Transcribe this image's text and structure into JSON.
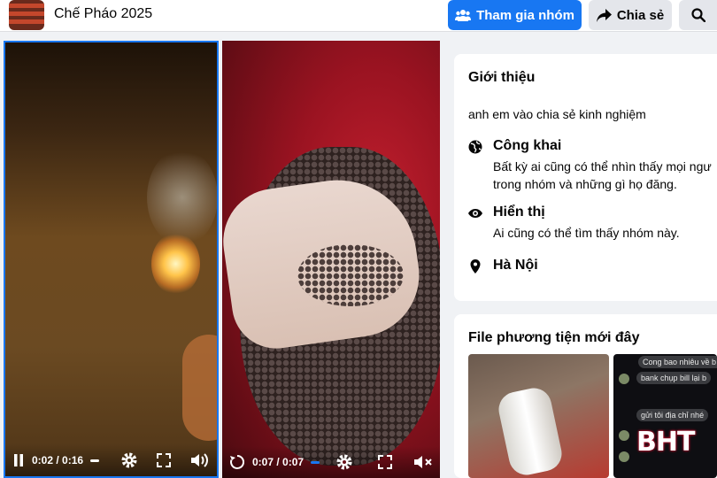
{
  "header": {
    "group_name": "Chế Pháo 2025",
    "join_button": "Tham gia nhóm",
    "share_button": "Chia sẻ",
    "icons": [
      "group-icon",
      "share-arrow-icon",
      "search-icon"
    ]
  },
  "media_viewer": {
    "video_1": {
      "time": "0:02 / 0:16"
    },
    "video_2": {
      "time": "0:07 / 0:07"
    },
    "icons": [
      "pause-icon",
      "replay-icon",
      "settings-icon",
      "fullscreen-icon",
      "volume-icon",
      "mute-icon"
    ]
  },
  "about": {
    "heading": "Giới thiệu",
    "description": "anh em vào chia sẻ kinh nghiệm",
    "privacy": {
      "title": "Công khai",
      "line1": "Bất kỳ ai cũng có thể nhìn thấy mọi ngư",
      "line2": "trong nhóm và những gì họ đăng."
    },
    "visibility": {
      "title": "Hiển thị",
      "line1": "Ai cũng có thể tìm thấy nhóm này."
    },
    "location": {
      "title": "Hà Nội"
    }
  },
  "recent_media": {
    "heading": "File phương tiện mới đây",
    "chat_lines": [
      "Cong bao nhiêu về b tr",
      "bank chụp bill lại b",
      "gửi tôi địa chỉ nhé"
    ],
    "watermark": "BHT"
  },
  "colors": {
    "accent": "#1877f2",
    "background": "#f0f2f5"
  }
}
